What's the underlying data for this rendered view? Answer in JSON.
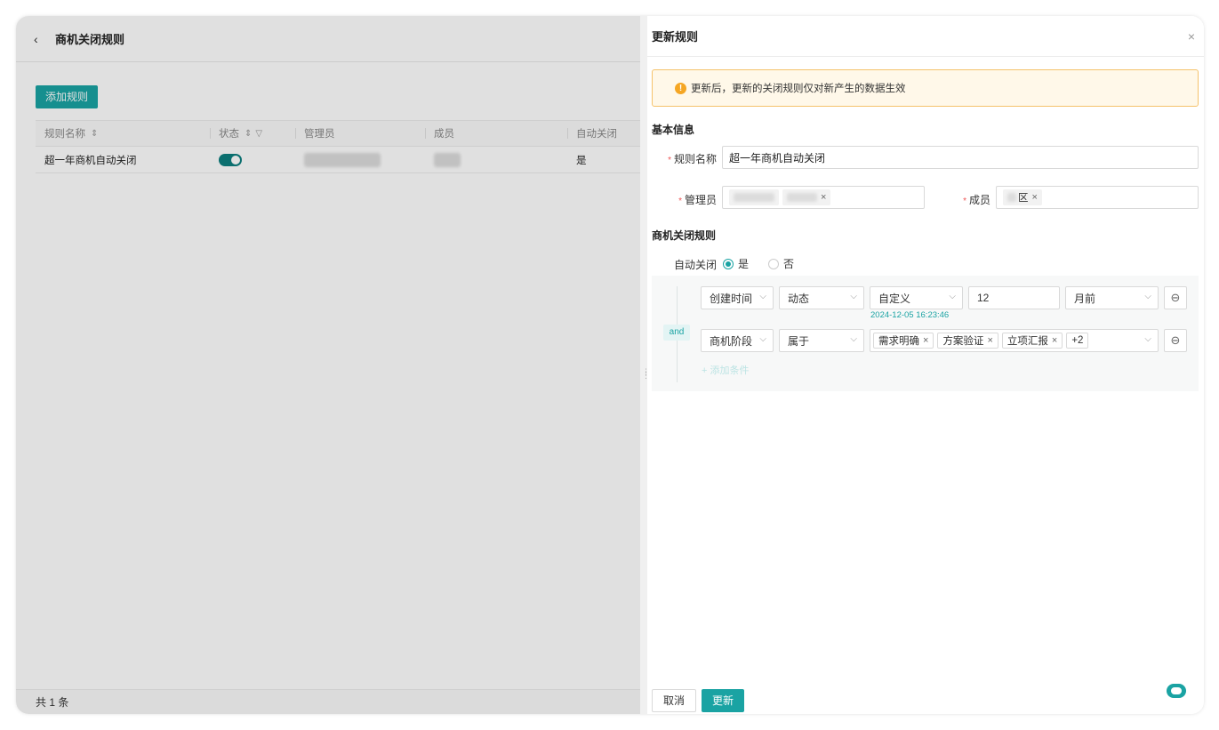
{
  "page": {
    "title": "商机关闭规则",
    "add_button": "添加规则",
    "columns": [
      "规则名称",
      "状态",
      "管理员",
      "成员",
      "自动关闭"
    ],
    "rows": [
      {
        "name": "超一年商机自动关闭",
        "status": "on",
        "auto_close": "是"
      }
    ],
    "total": "共 1 条"
  },
  "drawer": {
    "title": "更新规则",
    "alert": "更新后，更新的关闭规则仅对新产生的数据生效",
    "basic_section": "基本信息",
    "name_label": "规则名称",
    "name_value": "超一年商机自动关闭",
    "admin_label": "管理员",
    "member_label": "成员",
    "member_tag": "区",
    "rule_section": "商机关闭规则",
    "auto_close_label": "自动关闭",
    "opt_yes": "是",
    "opt_no": "否",
    "and_label": "and",
    "cond1": {
      "field": "创建时间",
      "op": "动态",
      "mode": "自定义",
      "value": "12",
      "unit": "月前",
      "date_hint": "2024-12-05 16:23:46"
    },
    "cond2": {
      "field": "商机阶段",
      "op": "属于",
      "tags": [
        "需求明确",
        "方案验证",
        "立项汇报"
      ],
      "more": "+2"
    },
    "add_condition": "+ 添加条件",
    "cancel": "取消",
    "update": "更新"
  },
  "colors": {
    "accent": "#1aa3a3",
    "warning": "#f5a623"
  },
  "icons": [
    "back-icon",
    "sort-icon",
    "filter-icon",
    "close-icon",
    "warning-icon",
    "chevron-down-icon",
    "minus-circle-icon",
    "bot-icon"
  ]
}
